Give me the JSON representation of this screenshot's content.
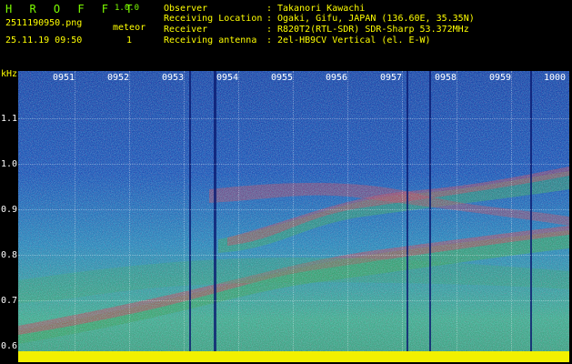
{
  "app": {
    "name": "H R O F F T",
    "version": "1.0.0"
  },
  "file": {
    "name": "2511190950.png",
    "datetime": "25.11.19 09:50"
  },
  "meteor": {
    "label": "meteor",
    "count": "1"
  },
  "info": [
    {
      "label": "Observer",
      "value": "Takanori Kawachi"
    },
    {
      "label": "Receiving Location",
      "value": "Ogaki, Gifu, JAPAN (136.60E, 35.35N)"
    },
    {
      "label": "Receiver",
      "value": "R820T2(RTL-SDR) SDR-Sharp 53.372MHz"
    },
    {
      "label": "Receiving antenna",
      "value": "2el-HB9CV Vertical (el. E-W)"
    }
  ],
  "axis": {
    "unit": "kHz",
    "yticks": [
      "1.1",
      "1.0",
      "0.9",
      "0.8",
      "0.7",
      "0.6"
    ],
    "xticks": [
      "0951",
      "0952",
      "0953",
      "0954",
      "0955",
      "0956",
      "0957",
      "0958",
      "0959",
      "1000"
    ]
  },
  "colors": {
    "title": "#7cfc00",
    "label": "#ffff00",
    "text": "#ffffff",
    "floor": "#f2f000"
  }
}
